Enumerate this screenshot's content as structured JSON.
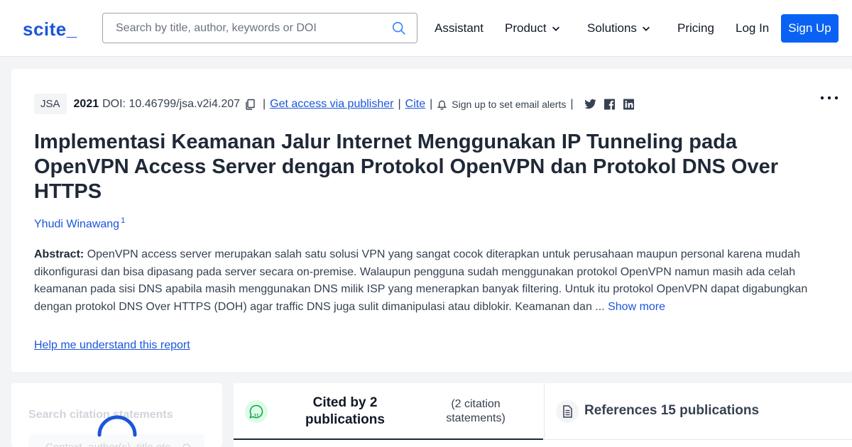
{
  "header": {
    "logo": "scite_",
    "search_placeholder": "Search by title, author, keywords or DOI",
    "nav": {
      "assistant": "Assistant",
      "product": "Product",
      "solutions": "Solutions",
      "pricing": "Pricing",
      "login": "Log In",
      "signup": "Sign Up"
    }
  },
  "article": {
    "journal": "JSA",
    "year": "2021",
    "doi": "DOI: 10.46799/jsa.v2i4.207",
    "access_link": "Get access via publisher",
    "cite_link": "Cite",
    "alert_text": "Sign up to set email alerts",
    "separator": "|",
    "title": "Implementasi Keamanan Jalur Internet Menggunakan IP Tunneling pada OpenVPN Access Server dengan Protokol OpenVPN dan Protokol DNS Over HTTPS",
    "author": "Yhudi Winawang",
    "author_affiliation": "1",
    "abstract_label": "Abstract:",
    "abstract": "OpenVPN access server merupakan salah satu solusi VPN yang sangat cocok diterapkan untuk perusahaan maupun personal karena mudah dikonfigurasi dan bisa dipasang pada server secara on-premise. Walaupun pengguna sudah menggunakan protokol OpenVPN namun masih ada celah keamanan pada sisi DNS apabila masih menggunakan DNS milik ISP yang menerapkan banyak filtering. Untuk itu protokol OpenVPN dapat digabungkan dengan protokol DNS Over HTTPS (DOH) agar traffic DNS juga sulit dimanipulasi atau diblokir. Keamanan dan ...",
    "show_more": "Show more",
    "help_link": "Help me understand this report"
  },
  "citations_panel": {
    "search_label": "Search citation statements",
    "search_placeholder": "Context, author(s), title etc"
  },
  "tabs": {
    "cited_title": "Cited by 2 publications",
    "cited_sub": "(2 citation statements)",
    "refs_title": "References 15 publications"
  },
  "icons": {
    "search": "search-icon",
    "chevron": "chevron-down-icon",
    "copy": "copy-icon",
    "bell": "bell-icon",
    "twitter": "twitter-icon",
    "facebook": "facebook-icon",
    "linkedin": "linkedin-icon",
    "more": "more-horizontal-icon",
    "cite": "quote-bubble-icon",
    "references": "document-icon"
  },
  "colors": {
    "brand": "#1a56db",
    "button": "#0a62f5",
    "cite_icon": "#16a34a"
  }
}
